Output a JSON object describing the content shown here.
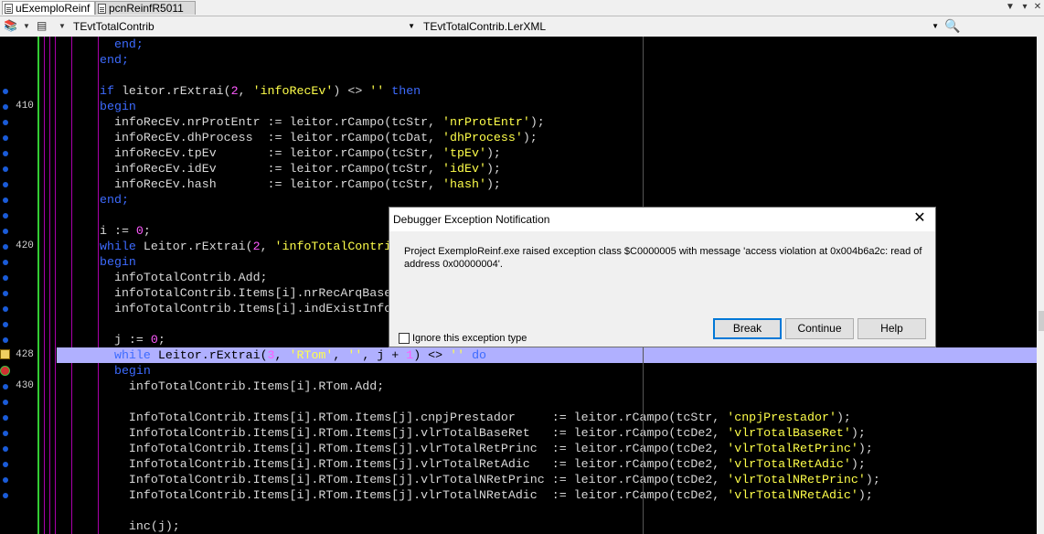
{
  "tabs": [
    {
      "label": "uExemploReinf",
      "active": true
    },
    {
      "label": "pcnReinfR5011",
      "active": false
    }
  ],
  "toolbar": {
    "class_combo": "TEvtTotalContrib",
    "method_combo": "TEvtTotalContrib.LerXML",
    "search_icon": "magnifier-icon"
  },
  "gutter": {
    "line_numbers": [
      "",
      "",
      "",
      "",
      "410",
      "",
      "",
      "",
      "",
      "",
      "",
      "",
      "",
      "420",
      "",
      "",
      "",
      "",
      "",
      "",
      "428",
      "",
      "430",
      "",
      "",
      "",
      "",
      "",
      ""
    ],
    "breakpoint_rows": [
      3,
      4,
      5,
      6,
      7,
      8,
      9,
      10,
      11,
      12,
      13,
      14,
      15,
      16,
      17,
      18,
      19,
      20,
      21,
      22,
      23,
      24,
      25,
      26,
      27,
      28,
      29
    ],
    "current_line": "428"
  },
  "code_lines": [
    [
      [
        "  end;",
        "kw"
      ]
    ],
    [
      [
        "end;",
        "kw"
      ]
    ],
    [
      [
        "",
        ""
      ]
    ],
    [
      [
        "if",
        "kw"
      ],
      [
        " leitor.rExtrai(",
        ""
      ],
      [
        "2",
        "num"
      ],
      [
        ", ",
        ""
      ],
      [
        "'infoRecEv'",
        "str"
      ],
      [
        ") <> ",
        ""
      ],
      [
        "''",
        "str"
      ],
      [
        " ",
        ""
      ],
      [
        "then",
        "kw"
      ]
    ],
    [
      [
        "begin",
        "kw"
      ]
    ],
    [
      [
        "  infoRecEv.nrProtEntr := leitor.rCampo(tcStr, ",
        ""
      ],
      [
        "'nrProtEntr'",
        "str"
      ],
      [
        ");",
        ""
      ]
    ],
    [
      [
        "  infoRecEv.dhProcess  := leitor.rCampo(tcDat, ",
        ""
      ],
      [
        "'dhProcess'",
        "str"
      ],
      [
        ");",
        ""
      ]
    ],
    [
      [
        "  infoRecEv.tpEv       := leitor.rCampo(tcStr, ",
        ""
      ],
      [
        "'tpEv'",
        "str"
      ],
      [
        ");",
        ""
      ]
    ],
    [
      [
        "  infoRecEv.idEv       := leitor.rCampo(tcStr, ",
        ""
      ],
      [
        "'idEv'",
        "str"
      ],
      [
        ");",
        ""
      ]
    ],
    [
      [
        "  infoRecEv.hash       := leitor.rCampo(tcStr, ",
        ""
      ],
      [
        "'hash'",
        "str"
      ],
      [
        ");",
        ""
      ]
    ],
    [
      [
        "end;",
        "kw"
      ]
    ],
    [
      [
        "",
        ""
      ]
    ],
    [
      [
        "i := ",
        ""
      ],
      [
        "0",
        "num"
      ],
      [
        ";",
        ""
      ]
    ],
    [
      [
        "while",
        "kw"
      ],
      [
        " Leitor.rExtrai(",
        ""
      ],
      [
        "2",
        "num"
      ],
      [
        ", ",
        ""
      ],
      [
        "'infoTotalContri",
        "str"
      ]
    ],
    [
      [
        "begin",
        "kw"
      ]
    ],
    [
      [
        "  infoTotalContrib.Add;",
        ""
      ]
    ],
    [
      [
        "  infoTotalContrib.Items[i].nrRecArqBase",
        ""
      ]
    ],
    [
      [
        "  infoTotalContrib.Items[i].indExistInfo",
        ""
      ]
    ],
    [
      [
        "",
        ""
      ]
    ],
    [
      [
        "  j := ",
        ""
      ],
      [
        "0",
        "num"
      ],
      [
        ";",
        ""
      ]
    ],
    [
      [
        "  ",
        ""
      ],
      [
        "while",
        "kw"
      ],
      [
        " Leitor.rExtrai(",
        ""
      ],
      [
        "3",
        "num"
      ],
      [
        ", ",
        ""
      ],
      [
        "'RTom'",
        "str"
      ],
      [
        ", ",
        ""
      ],
      [
        "''",
        "str"
      ],
      [
        ", j + ",
        ""
      ],
      [
        "1",
        "num"
      ],
      [
        ") <> ",
        ""
      ],
      [
        "''",
        "str"
      ],
      [
        " ",
        ""
      ],
      [
        "do",
        "kw"
      ]
    ],
    [
      [
        "  ",
        ""
      ],
      [
        "begin",
        "kw"
      ]
    ],
    [
      [
        "    infoTotalContrib.Items[i].RTom.Add;",
        ""
      ]
    ],
    [
      [
        "",
        ""
      ]
    ],
    [
      [
        "    InfoTotalContrib.Items[i].RTom.Items[j].cnpjPrestador     := leitor.rCampo(tcStr, ",
        ""
      ],
      [
        "'cnpjPrestador'",
        "str"
      ],
      [
        ");",
        ""
      ]
    ],
    [
      [
        "    InfoTotalContrib.Items[i].RTom.Items[j].vlrTotalBaseRet   := leitor.rCampo(tcDe2, ",
        ""
      ],
      [
        "'vlrTotalBaseRet'",
        "str"
      ],
      [
        ");",
        ""
      ]
    ],
    [
      [
        "    InfoTotalContrib.Items[i].RTom.Items[j].vlrTotalRetPrinc  := leitor.rCampo(tcDe2, ",
        ""
      ],
      [
        "'vlrTotalRetPrinc'",
        "str"
      ],
      [
        ");",
        ""
      ]
    ],
    [
      [
        "    InfoTotalContrib.Items[i].RTom.Items[j].vlrTotalRetAdic   := leitor.rCampo(tcDe2, ",
        ""
      ],
      [
        "'vlrTotalRetAdic'",
        "str"
      ],
      [
        ");",
        ""
      ]
    ],
    [
      [
        "    InfoTotalContrib.Items[i].RTom.Items[j].vlrTotalNRetPrinc := leitor.rCampo(tcDe2, ",
        ""
      ],
      [
        "'vlrTotalNRetPrinc'",
        "str"
      ],
      [
        ");",
        ""
      ]
    ],
    [
      [
        "    InfoTotalContrib.Items[i].RTom.Items[j].vlrTotalNRetAdic  := leitor.rCampo(tcDe2, ",
        ""
      ],
      [
        "'vlrTotalNRetAdic'",
        "str"
      ],
      [
        ");",
        ""
      ]
    ],
    [
      [
        "",
        ""
      ]
    ],
    [
      [
        "    inc(j);",
        ""
      ]
    ]
  ],
  "dialog": {
    "title": "Debugger Exception Notification",
    "message": "Project ExemploReinf.exe raised exception class $C0000005 with message 'access violation at 0x004b6a2c: read of address 0x00000004'.",
    "checkbox_label": "Ignore this exception type",
    "checkbox_checked": false,
    "buttons": {
      "break": "Break",
      "continue": "Continue",
      "help": "Help"
    },
    "default_button": "Break"
  },
  "colors": {
    "editor_background": "#000000",
    "keyword": "#3d6bff",
    "string": "#ffff4a",
    "number": "#ff5aff",
    "current_line_highlight": "#b0b0ff",
    "breakpoint_dot": "#1a5bd8"
  }
}
